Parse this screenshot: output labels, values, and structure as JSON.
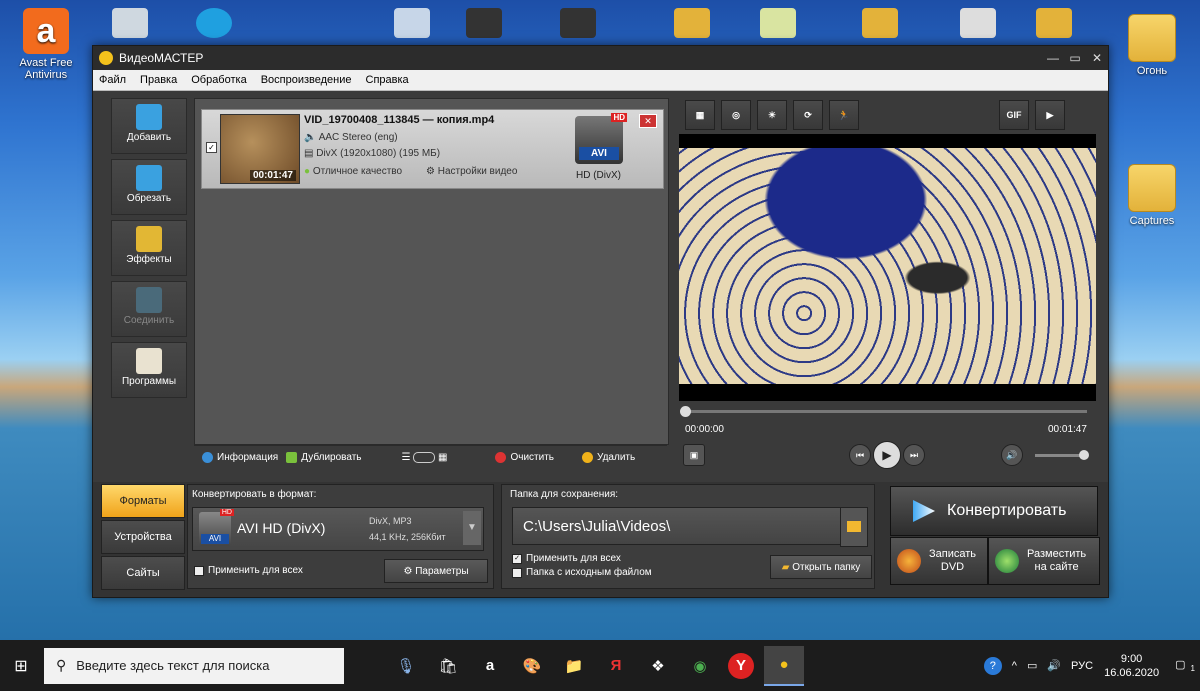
{
  "desktop": {
    "icons": [
      {
        "label": "Avast Free Antivirus",
        "glyph": "a"
      },
      {
        "label": "Огонь"
      },
      {
        "label": "Captures"
      }
    ]
  },
  "window": {
    "title": "ВидеоМАСТЕР",
    "controls": [
      "—",
      "▭",
      "✕"
    ]
  },
  "menu": [
    "Файл",
    "Правка",
    "Обработка",
    "Воспроизведение",
    "Справка"
  ],
  "left_tools": [
    {
      "label": "Добавить",
      "icon": "add-video-icon",
      "color": "#3aa1e0"
    },
    {
      "label": "Обрезать",
      "icon": "cut-video-icon",
      "color": "#3aa1e0"
    },
    {
      "label": "Эффекты",
      "icon": "effects-icon",
      "color": "#e2b734"
    },
    {
      "label": "Соединить",
      "icon": "join-icon",
      "color": "#4a6a7a"
    },
    {
      "label": "Программы",
      "icon": "programs-icon",
      "color": "#e9e2d0"
    }
  ],
  "file": {
    "name": "VID_19700408_113845 — копия.mp4",
    "duration": "00:01:47",
    "audio": "AAC Stereo (eng)",
    "video": "DivX (1920x1080) (195 МБ)",
    "quality": "Отличное качество",
    "settings": "Настройки видео",
    "format_badge": "AVI",
    "hd_badge": "HD",
    "format_label": "HD (DivX)",
    "checked": "✓",
    "delete_glyph": "✕"
  },
  "list_bar": {
    "info": "Информация",
    "duplicate": "Дублировать",
    "clear": "Очистить",
    "remove": "Удалить"
  },
  "preview_tools": [
    {
      "icon": "crop-icon",
      "glyph": "▦"
    },
    {
      "icon": "stabilize-icon",
      "glyph": "◎"
    },
    {
      "icon": "brightness-icon",
      "glyph": "☀"
    },
    {
      "icon": "rotate-icon",
      "glyph": "⟳"
    },
    {
      "icon": "speed-icon",
      "glyph": "🏃"
    },
    {
      "icon": "gif-icon",
      "glyph": "GIF"
    },
    {
      "icon": "fullscreen-icon",
      "glyph": "▶"
    }
  ],
  "player": {
    "time_current": "00:00:00",
    "time_total": "00:01:47",
    "progress": 0,
    "volume": 1.0,
    "snapshot_glyph": "▣",
    "prev_glyph": "⏮",
    "play_glyph": "▶",
    "next_glyph": "⏭",
    "volume_glyph": "🔊"
  },
  "bottom": {
    "tabs": [
      "Форматы",
      "Устройства",
      "Сайты"
    ],
    "convert_to_label": "Конвертировать в формат:",
    "format_name": "AVI HD (DivX)",
    "format_spec1": "DivX, MP3",
    "format_spec2": "44,1 KHz, 256Кбит",
    "dropdown_glyph": "▼",
    "apply_all": "Применить для всех",
    "params": "Параметры",
    "save_folder_label": "Папка для сохранения:",
    "save_path": "C:\\Users\\Julia\\Videos\\",
    "apply_all2": "Применить для всех",
    "source_folder": "Папка с исходным файлом",
    "open_folder": "Открыть папку",
    "convert": "Конвертировать",
    "burn_dvd_1": "Записать",
    "burn_dvd_2": "DVD",
    "publish_1": "Разместить",
    "publish_2": "на сайте"
  },
  "taskbar": {
    "start_glyph": "⊞",
    "search_glyph": "⚲",
    "search_placeholder": "Введите здесь текст для поиска",
    "apps": [
      {
        "icon": "microphone-app-icon",
        "glyph": "🎙"
      },
      {
        "icon": "store-icon",
        "glyph": "🛍"
      },
      {
        "icon": "amazon-icon",
        "glyph": "a"
      },
      {
        "icon": "paint-icon",
        "glyph": "🎨"
      },
      {
        "icon": "explorer-icon",
        "glyph": "📁"
      },
      {
        "icon": "yandex-icon",
        "glyph": "Я"
      },
      {
        "icon": "dropbox-icon",
        "glyph": "❖"
      },
      {
        "icon": "chrome-icon",
        "glyph": "◉"
      },
      {
        "icon": "yandex-browser-icon",
        "glyph": "Y"
      },
      {
        "icon": "videomaster-icon",
        "glyph": "●"
      }
    ],
    "help_glyph": "?",
    "chevron_glyph": "^",
    "lang": "РУС",
    "time": "9:00",
    "date": "16.06.2020",
    "notification_glyph": "▢",
    "notification_count": "1"
  }
}
